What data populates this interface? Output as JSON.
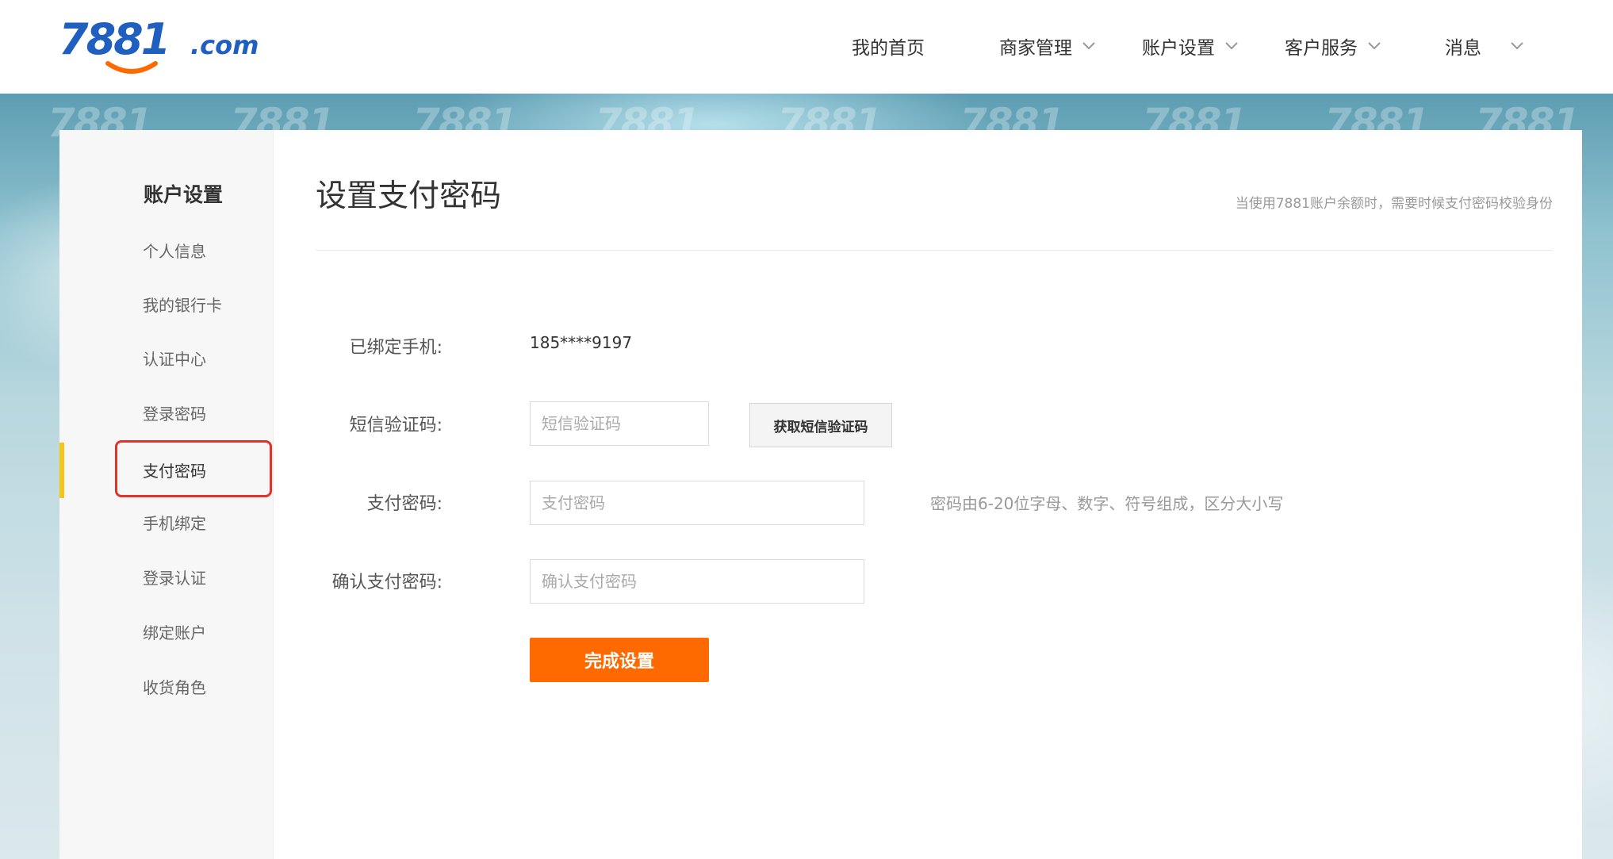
{
  "header": {
    "logo_text": "7881.com",
    "nav": [
      {
        "label": "我的首页",
        "has_dropdown": false
      },
      {
        "label": "商家管理",
        "has_dropdown": true
      },
      {
        "label": "账户设置",
        "has_dropdown": true
      },
      {
        "label": "客户服务",
        "has_dropdown": true
      },
      {
        "label": "消息",
        "has_dropdown": true
      }
    ]
  },
  "sidebar": {
    "title": "账户设置",
    "items": [
      {
        "label": "个人信息",
        "active": false
      },
      {
        "label": "我的银行卡",
        "active": false
      },
      {
        "label": "认证中心",
        "active": false
      },
      {
        "label": "登录密码",
        "active": false
      },
      {
        "label": "支付密码",
        "active": true
      },
      {
        "label": "手机绑定",
        "active": false
      },
      {
        "label": "登录认证",
        "active": false
      },
      {
        "label": "绑定账户",
        "active": false
      },
      {
        "label": "收货角色",
        "active": false
      }
    ]
  },
  "main": {
    "title": "设置支付密码",
    "hint": "当使用7881账户余额时，需要时候支付密码校验身份",
    "form": {
      "phone_label": "已绑定手机:",
      "phone_value": "185****9197",
      "sms_label": "短信验证码:",
      "sms_placeholder": "短信验证码",
      "sms_button": "获取短信验证码",
      "pwd_label": "支付密码:",
      "pwd_placeholder": "支付密码",
      "pwd_rule": "密码由6-20位字母、数字、符号组成，区分大小写",
      "confirm_label": "确认支付密码:",
      "confirm_placeholder": "确认支付密码",
      "submit": "完成设置"
    }
  },
  "colors": {
    "accent_orange": "#ff6a00",
    "logo_blue": "#1f5fbf",
    "logo_orange": "#ff6a00",
    "active_bar": "#f5c518",
    "highlight_red": "#e0332b"
  }
}
